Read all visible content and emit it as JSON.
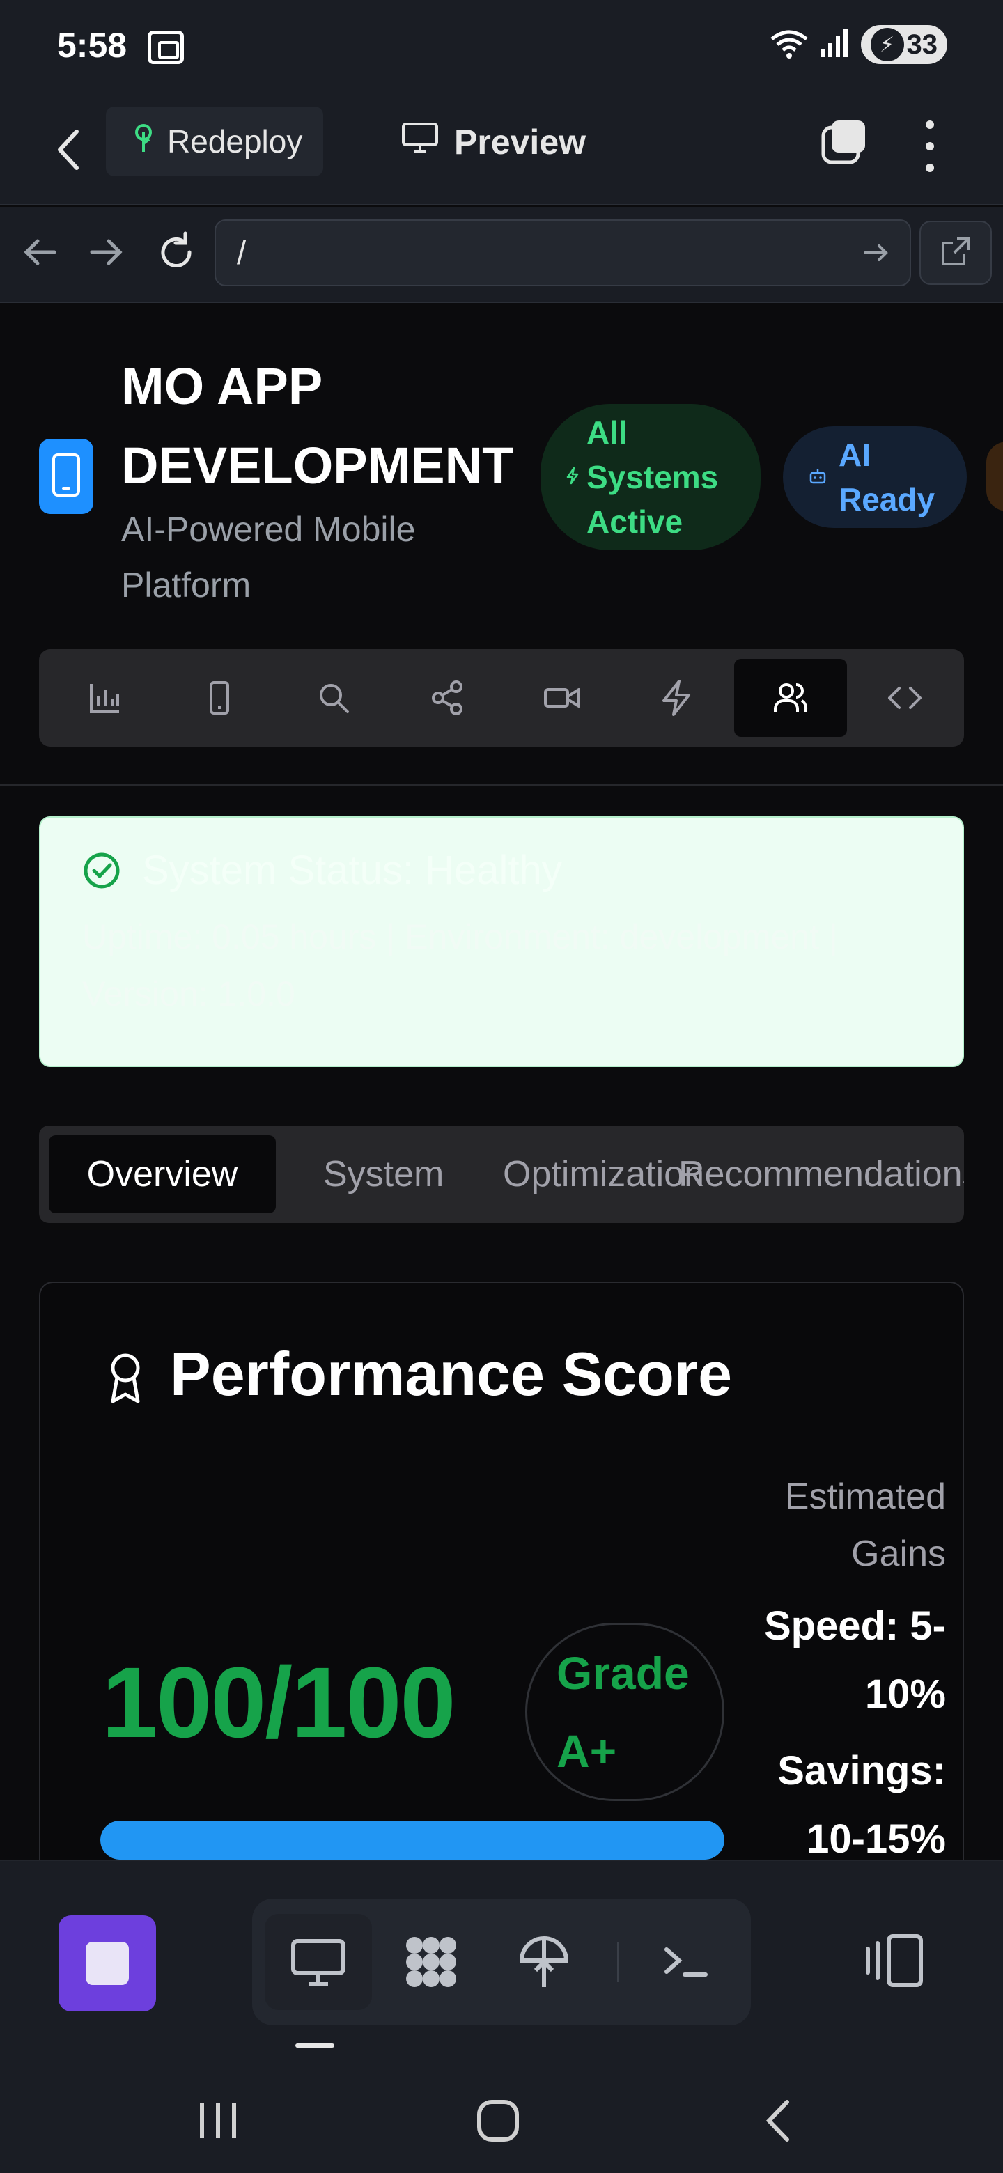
{
  "status_bar": {
    "time": "5:58",
    "battery": "33"
  },
  "toolbar": {
    "redeploy_label": "Redeploy",
    "preview_label": "Preview"
  },
  "url_bar": {
    "value": "/"
  },
  "app": {
    "title_line1": "MO APP",
    "title_line2": "DEVELOPMENT",
    "subtitle_line1": "AI-Powered Mobile",
    "subtitle_line2": "Platform",
    "badge_active": [
      "All",
      "Systems",
      "Active"
    ],
    "badge_ai": [
      "AI",
      "Ready"
    ]
  },
  "icon_tabs": [
    "analytics",
    "mobile",
    "search",
    "share",
    "video",
    "performance",
    "team",
    "code"
  ],
  "active_icon_tab": "team",
  "status_card": {
    "title": "System Status: Healthy",
    "detail": "Uptime: 0.05 hours | Environment: development | Version: 1.0.0"
  },
  "tabs": [
    "Overview",
    "System",
    "Optimization",
    "Recommendations"
  ],
  "active_tab": "Overview",
  "performance": {
    "title": "Performance Score",
    "score": "100/100",
    "grade_line1": "Grade",
    "grade_line2": "A+",
    "gains_label_line1": "Estimated",
    "gains_label_line2": "Gains",
    "speed_line1": "Speed: 5-",
    "speed_line2": "10%",
    "savings_line1": "Savings:",
    "savings_line2": "10-15%",
    "progress_percent": 100
  },
  "colors": {
    "accent_green": "#16a34a",
    "accent_blue": "#2196f3",
    "stop_purple": "#6d3fdd"
  }
}
